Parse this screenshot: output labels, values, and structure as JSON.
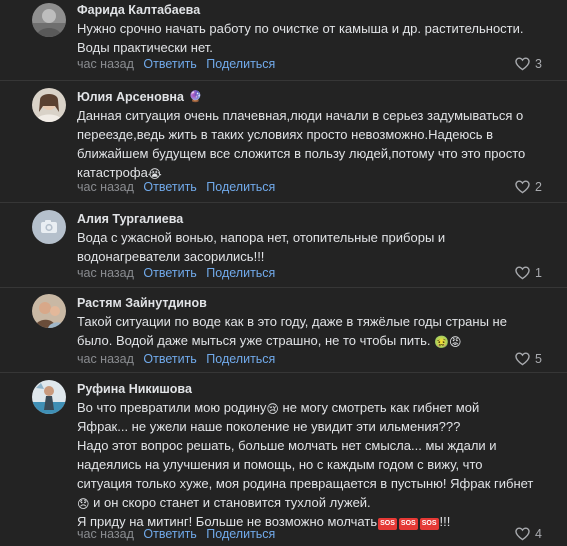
{
  "comments": [
    {
      "author": "Фарида Калтабаева",
      "badge": "",
      "lines": [
        "Нужно срочно начать работу по очистке от камыша и др. растительности.",
        "Воды практически нет."
      ],
      "time": "час назад",
      "reply_label": "Ответить",
      "share_label": "Поделиться",
      "likes": "3",
      "avatar_icon": "user-photo"
    },
    {
      "author": "Юлия Арсеновна",
      "badge": "🔮",
      "lines": [
        "Данная ситуация очень плачевная,люди начали в серьез задумываться о",
        "переезде,ведь жить в таких условиях просто невозможно.Надеюсь в",
        "ближайшем будущем все сложится в пользу людей,потому что это просто",
        "катастрофа"
      ],
      "emoji_end": "😭",
      "time": "час назад",
      "reply_label": "Ответить",
      "share_label": "Поделиться",
      "likes": "2",
      "avatar_icon": "user-photo"
    },
    {
      "author": "Алия Тургалиева",
      "badge": "",
      "lines": [
        "Вода с ужасной вонью, напора нет, отопительные приборы и",
        "водонагреватели засорились!!!"
      ],
      "time": "час назад",
      "reply_label": "Ответить",
      "share_label": "Поделиться",
      "likes": "1",
      "avatar_icon": "camera-placeholder-icon"
    },
    {
      "author": "Растям Зайнутдинов",
      "badge": "",
      "lines": [
        "Такой ситуации по воде как в это году, даже в тяжёлые годы страны не",
        "было. Водой даже мыться уже страшно, не то чтобы пить."
      ],
      "emoji_end": "🤢😡",
      "time": "час назад",
      "reply_label": "Ответить",
      "share_label": "Поделиться",
      "likes": "5",
      "avatar_icon": "user-photo"
    },
    {
      "author": "Руфина Никишова",
      "badge": "",
      "lines": [
        "Во что превратили мою родину",
        "Яфрак... не ужели наше поколение не увидит эти ильмения???",
        "Надо этот вопрос решать, больше молчать нет смысла... мы ждали и",
        "надеялись на улучшения и помощь, но с каждым годом с вижу, что",
        "ситуация только хуже, моя родина превращается в пустыню! Яфрак гибнет",
        "и он скоро станет и становится тухлой лужей.",
        "Я приду на митинг! Больше не возможно молчать"
      ],
      "line1_tail": " не могу смотреть как гибнет мой",
      "line1_emoji": "😢",
      "line6_emoji": "😞",
      "sos_label": "SOS",
      "line7_tail": "!!!",
      "time": "час назад",
      "reply_label": "Ответить",
      "share_label": "Поделиться",
      "likes": "4",
      "avatar_icon": "user-photo"
    }
  ],
  "colors": {
    "background": "#232323",
    "text": "#e1e3e6",
    "secondary": "#8a8c90",
    "accent": "#71aaeb"
  }
}
